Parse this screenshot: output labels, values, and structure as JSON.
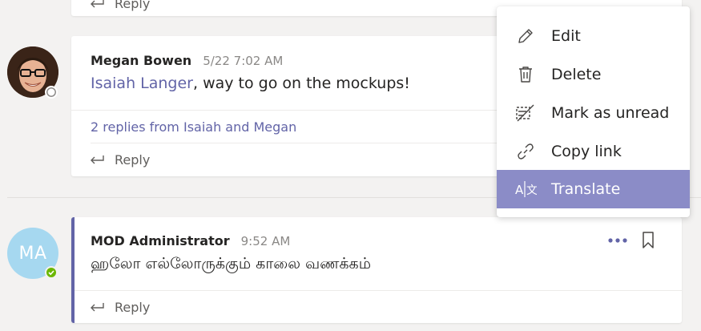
{
  "top_card": {
    "reply_label": "Reply"
  },
  "thread1": {
    "author": "Megan Bowen",
    "time": "5/22 7:02 AM",
    "mention": "Isaiah Langer",
    "text": ", way to go on the mockups!",
    "replies_link": "2 replies from Isaiah and Megan",
    "reply_label": "Reply"
  },
  "thread2": {
    "avatar_initials": "MA",
    "author": "MOD Administrator",
    "time": "9:52 AM",
    "text": "ஹலோ எல்லோருக்கும் காலை வணக்கம்",
    "reply_label": "Reply"
  },
  "context_menu": {
    "items": [
      {
        "label": "Edit",
        "icon": "pencil-icon"
      },
      {
        "label": "Delete",
        "icon": "trash-icon"
      },
      {
        "label": "Mark as unread",
        "icon": "mark-unread-icon"
      },
      {
        "label": "Copy link",
        "icon": "link-icon"
      },
      {
        "label": "Translate",
        "icon": "translate-icon"
      }
    ]
  },
  "colors": {
    "accent": "#6264a7",
    "menu_highlight": "#8b8cc7",
    "presence_available": "#6bb700",
    "avatar_bg": "#a6d8f0"
  }
}
